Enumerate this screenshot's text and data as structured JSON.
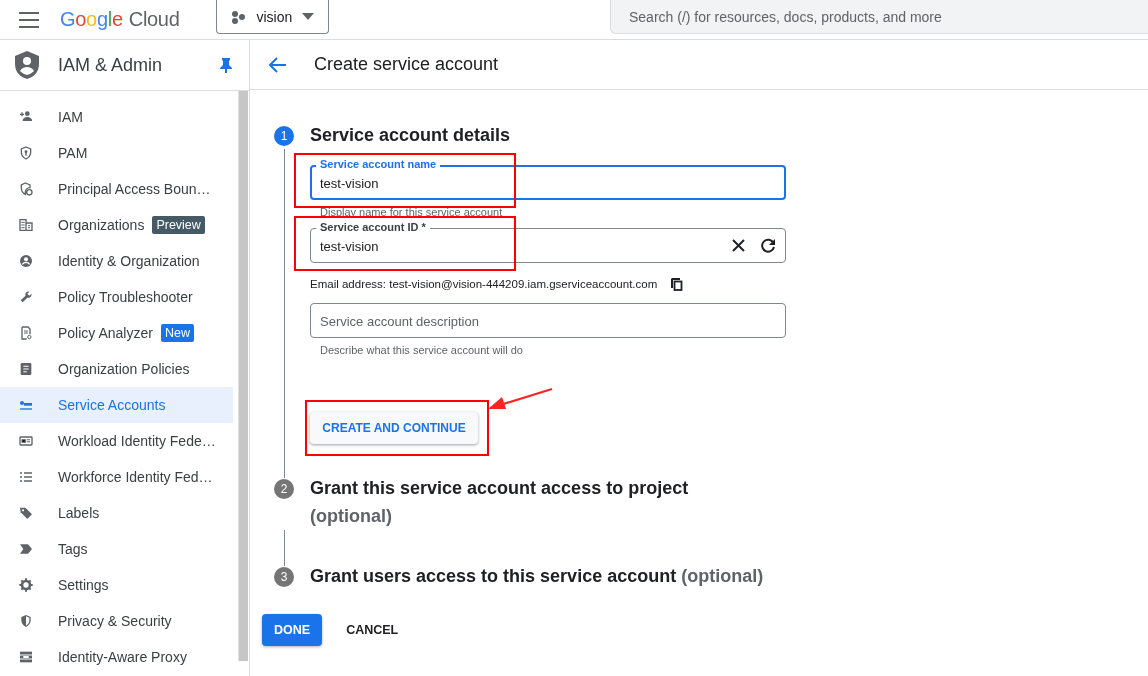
{
  "top_bar": {
    "logo_primary": "Google",
    "logo_secondary": "Cloud",
    "project": "vision",
    "search": {
      "placeholder": "Search (/) for resources, docs, products, and more"
    }
  },
  "sidebar": {
    "title": "IAM & Admin",
    "pinned": true,
    "items": [
      {
        "label": "IAM",
        "selected": false
      },
      {
        "label": "PAM",
        "selected": false
      },
      {
        "label": "Principal Access Boun…",
        "selected": false
      },
      {
        "label": "Organizations",
        "selected": false,
        "badge": {
          "text": "Preview",
          "color": "#455a64"
        }
      },
      {
        "label": "Identity & Organization",
        "selected": false
      },
      {
        "label": "Policy Troubleshooter",
        "selected": false
      },
      {
        "label": "Policy Analyzer",
        "selected": false,
        "badge": {
          "text": "New",
          "color": "#1a73e8"
        }
      },
      {
        "label": "Organization Policies",
        "selected": false
      },
      {
        "label": "Service Accounts",
        "selected": true
      },
      {
        "label": "Workload Identity Fede…",
        "selected": false
      },
      {
        "label": "Workforce Identity Fed…",
        "selected": false
      },
      {
        "label": "Labels",
        "selected": false
      },
      {
        "label": "Tags",
        "selected": false
      },
      {
        "label": "Settings",
        "selected": false
      },
      {
        "label": "Privacy & Security",
        "selected": false
      },
      {
        "label": "Identity-Aware Proxy",
        "selected": false
      }
    ]
  },
  "page": {
    "title": "Create service account"
  },
  "steps": [
    {
      "number": "1",
      "title": "Service account details",
      "active": true
    },
    {
      "number": "2",
      "title": "Grant this service account access to project",
      "optional": "(optional)",
      "active": false
    },
    {
      "number": "3",
      "title": "Grant users access to this service account",
      "optional": "(optional)",
      "active": false
    }
  ],
  "form": {
    "fields": [
      {
        "label": "Service account name",
        "value": "test-vision",
        "focused": true,
        "clearable": false,
        "highlighted": true,
        "helper": "Display name for this service account"
      },
      {
        "label": "Service account ID *",
        "value": "test-vision",
        "focused": false,
        "clearable": true,
        "highlighted": true,
        "note": "Email address: test-vision@vision-444209.iam.gserviceaccount.com"
      },
      {
        "placeholder": "Service account description",
        "focused": false,
        "clearable": false,
        "highlighted": false,
        "helper": "Describe what this service account will do"
      }
    ],
    "submit": {
      "label": "CREATE AND CONTINUE",
      "highlighted": true,
      "pointed": true
    }
  },
  "actions": [
    {
      "label": "DONE",
      "kind": "primary"
    },
    {
      "label": "CANCEL",
      "kind": "text"
    }
  ]
}
